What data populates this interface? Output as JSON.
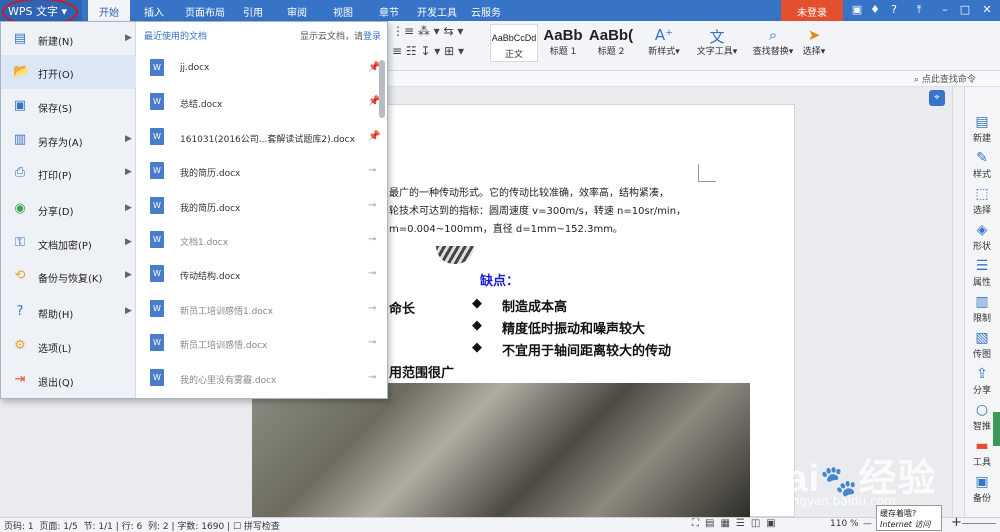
{
  "topbar": {
    "app_name": "WPS 文字",
    "tabs": [
      "开始",
      "插入",
      "页面布局",
      "引用",
      "审阅",
      "视图",
      "章节",
      "开发工具",
      "云服务"
    ],
    "login": "未登录"
  },
  "ribbon": {
    "styles": [
      {
        "sample": "AaBbCcDd",
        "name": "正文"
      },
      {
        "sample": "AaBb",
        "name": "标题 1"
      },
      {
        "sample": "AaBb(",
        "name": "标题 2"
      }
    ],
    "tools": [
      "新样式",
      "文字工具",
      "查找替换",
      "选择"
    ],
    "find_command": "点此查找命令"
  },
  "menu": {
    "items": [
      {
        "label": "新建(N)",
        "icon": "new-icon",
        "arrow": true
      },
      {
        "label": "打开(O)",
        "icon": "open-folder-icon",
        "arrow": false
      },
      {
        "label": "保存(S)",
        "icon": "save-icon",
        "arrow": false
      },
      {
        "label": "另存为(A)",
        "icon": "save-as-icon",
        "arrow": true
      },
      {
        "label": "打印(P)",
        "icon": "print-icon",
        "arrow": true
      },
      {
        "label": "分享(D)",
        "icon": "share-icon",
        "arrow": true
      },
      {
        "label": "文档加密(P)",
        "icon": "encrypt-icon",
        "arrow": true
      },
      {
        "label": "备份与恢复(K)",
        "icon": "backup-icon",
        "arrow": true
      },
      {
        "label": "帮助(H)",
        "icon": "help-icon",
        "arrow": true
      },
      {
        "label": "选项(L)",
        "icon": "options-icon",
        "arrow": false
      },
      {
        "label": "退出(Q)",
        "icon": "exit-icon",
        "arrow": false
      }
    ],
    "recent_title": "最近使用的文档",
    "cloud_prefix": "显示云文档，请",
    "cloud_link": "登录",
    "recent_files": [
      {
        "name": "jj.docx",
        "pinned": true,
        "dim": false
      },
      {
        "name": "总结.docx",
        "pinned": true,
        "dim": false
      },
      {
        "name": "161031(2016公司...套解读试题库2).docx",
        "pinned": true,
        "dim": false
      },
      {
        "name": "我的简历.docx",
        "pinned": false,
        "dim": false
      },
      {
        "name": "我的简历.docx",
        "pinned": false,
        "dim": false
      },
      {
        "name": "文档1.docx",
        "pinned": false,
        "dim": true
      },
      {
        "name": "传动结构.docx",
        "pinned": false,
        "dim": false
      },
      {
        "name": "新员工培训感悟1.docx",
        "pinned": false,
        "dim": true
      },
      {
        "name": "新员工培训感悟.docx",
        "pinned": false,
        "dim": true
      },
      {
        "name": "我的心里没有雾霾.docx",
        "pinned": false,
        "dim": true
      }
    ]
  },
  "document": {
    "line1": "最广的一种传动形式。它的传动比较准确，效率高，结构紧凑，",
    "line2": "轮技术可达到的指标：圆周速度 v=300m/s，转速 n=10sr/min，",
    "line3": "m=0.004~100mm，直径 d=1mm~152.3mm。",
    "cons_title": "缺点：",
    "left_frag1": "命长",
    "left_frag2": "用范围很广",
    "cons": [
      "制造成本高",
      "精度低时振动和噪声较大",
      "不宜用于轴间距离较大的传动"
    ]
  },
  "right_panel": [
    "新建",
    "样式",
    "选择",
    "形状",
    "属性",
    "限制",
    "传图",
    "分享",
    "智推",
    "工具",
    "备份"
  ],
  "status": {
    "page_code": "页码: 1",
    "pages": "页面: 1/5",
    "section": "节: 1/1",
    "row": "行: 6",
    "col": "列: 2",
    "words": "字数: 1690",
    "spell": "拼写检查",
    "zoom": "110 %"
  },
  "tooltip": {
    "line1": "缓存着哦?",
    "line2": "Internet 访问"
  },
  "watermark": {
    "brand": "Bai经验",
    "url": "jingyan.baidu.com"
  },
  "colors": {
    "accent": "#3773c6",
    "login": "#e3502e",
    "cons_title": "#1a1ae0"
  }
}
